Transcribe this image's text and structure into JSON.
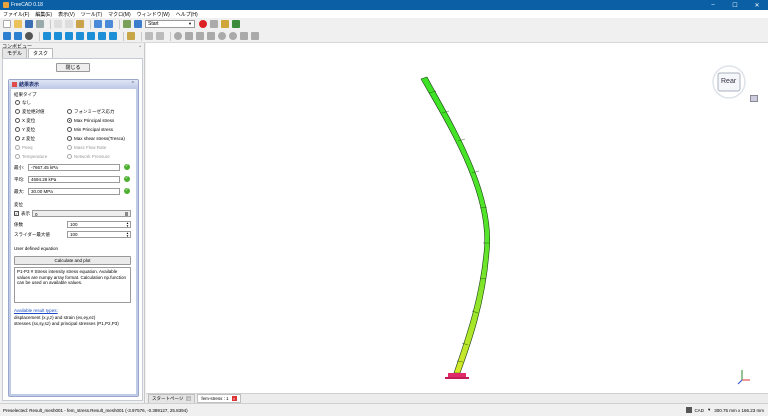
{
  "window": {
    "title": "FreeCAD 0.18",
    "controls": [
      "–",
      "☐",
      "✕"
    ]
  },
  "menu": [
    "ファイル(F)",
    "編集(E)",
    "表示(V)",
    "ツール(T)",
    "マクロ(M)",
    "ウィンドウ(W)",
    "ヘルプ(H)"
  ],
  "workbench": {
    "selected": "Start"
  },
  "combo_view": {
    "title": "コンボビュー",
    "tabs": [
      "モデル",
      "タスク"
    ],
    "active_tab": "タスク"
  },
  "task": {
    "close_label": "閉じる",
    "panel_title": "結果表示",
    "result_type_label": "結果タイプ",
    "radios_left": [
      {
        "label": "なし",
        "selected": false,
        "enabled": true
      },
      {
        "label": "変位絶対値",
        "selected": false,
        "enabled": true
      },
      {
        "label": "X 変位",
        "selected": false,
        "enabled": true
      },
      {
        "label": "Y 変位",
        "selected": false,
        "enabled": true
      },
      {
        "label": "Z 変位",
        "selected": false,
        "enabled": true
      },
      {
        "label": "Peeq",
        "selected": false,
        "enabled": false
      },
      {
        "label": "Temperature",
        "selected": false,
        "enabled": false
      }
    ],
    "radios_right": [
      {
        "label": "フォンミーゼス応力",
        "selected": false,
        "enabled": true
      },
      {
        "label": "Max Principal stress",
        "selected": true,
        "enabled": true
      },
      {
        "label": "Min Principal stress",
        "selected": false,
        "enabled": true
      },
      {
        "label": "Max shear stress(Tresca)",
        "selected": false,
        "enabled": true
      },
      {
        "label": "Mass Flow Rate",
        "selected": false,
        "enabled": false
      },
      {
        "label": "Network Pressure",
        "selected": false,
        "enabled": false
      }
    ],
    "stats": [
      {
        "label": "最小:",
        "value": "-7667.45 kPa"
      },
      {
        "label": "平均:",
        "value": "4694.28 kPa"
      },
      {
        "label": "最大:",
        "value": "30.00 MPa"
      }
    ],
    "displacement": {
      "section_label": "変位",
      "show_label": "表示",
      "slider_value": "0",
      "factor_label": "係数",
      "factor_value": "100",
      "slider_max_label": "スライダー最大値",
      "slider_max_value": "100"
    },
    "equation": {
      "label": "User defined equation",
      "button": "Calculate and plot",
      "text": "P1-P3 # Stress intensity stress equation. Available values are numpy array format. Calculation np.function can be used on available values."
    },
    "help": {
      "link": "Available result types:",
      "line1": "displacement (x,y,z) and strain (ex,ey,ez)",
      "line2": "stresses (sx,sy,sz) and principal stresses (P1,P2,P3)"
    }
  },
  "viewport": {
    "navcube_face": "Rear"
  },
  "doc_tabs": [
    {
      "label": "スタートページ",
      "active": false
    },
    {
      "label": "fem-stress : 1",
      "active": true
    }
  ],
  "status": {
    "preselected": "Preselected: Result_mesh001 - fem_stress.Result_mesh001 (-3.97576, -0.389127, 25.8394)",
    "nav_style": "CAD",
    "dimensions": "300.75 mm x 166.23 mm"
  },
  "colors": {
    "accent": "#0b5fa5",
    "beam_high": "#33dd22",
    "beam_low": "#ddee22"
  }
}
